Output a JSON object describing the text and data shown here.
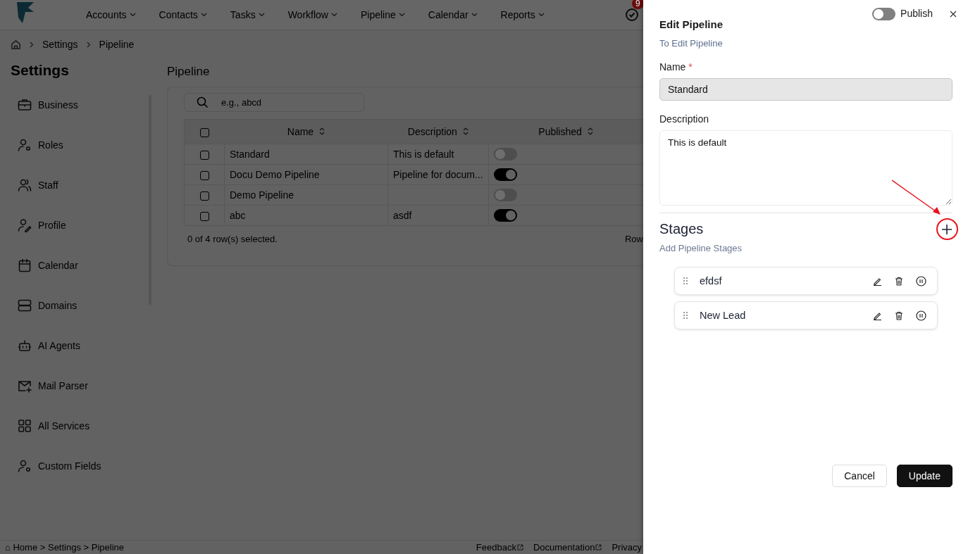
{
  "nav": {
    "items": [
      {
        "label": "Accounts"
      },
      {
        "label": "Contacts"
      },
      {
        "label": "Tasks"
      },
      {
        "label": "Workflow"
      },
      {
        "label": "Pipeline"
      },
      {
        "label": "Calendar"
      },
      {
        "label": "Reports"
      }
    ],
    "badge": "9"
  },
  "breadcrumb": [
    "Settings",
    "Pipeline"
  ],
  "sidebar": {
    "title": "Settings",
    "items": [
      "Business",
      "Roles",
      "Staff",
      "Profile",
      "Calendar",
      "Domains",
      "AI Agents",
      "Mail Parser",
      "All Services",
      "Custom Fields"
    ]
  },
  "main": {
    "title": "Pipeline",
    "search": {
      "placeholder": "e.g., abcd"
    },
    "table": {
      "columns": [
        "Name",
        "Description",
        "Published"
      ],
      "rows": [
        {
          "name": "Standard",
          "description": "This is default",
          "published": false,
          "checked": false
        },
        {
          "name": "Docu Demo Pipeline",
          "description": "Pipeline for docum...",
          "published": true,
          "checked": false
        },
        {
          "name": "Demo Pipeline",
          "description": "",
          "published": false,
          "checked": false
        },
        {
          "name": "abc",
          "description": "asdf",
          "published": true,
          "checked": false
        }
      ],
      "header_checked": false,
      "selection": "0 of 4 row(s) selected.",
      "rows_label": "Row"
    }
  },
  "footer": {
    "path": "⌂ Home >  Settings >  Pipeline",
    "links": [
      "Feedback",
      "Documentation",
      "Privacy"
    ]
  },
  "drawer": {
    "title": "Edit Pipeline",
    "subtitle": "To Edit Pipeline",
    "publish": {
      "label": "Publish",
      "on": false
    },
    "name_label": "Name",
    "required": "*",
    "name_value": "Standard",
    "description_label": "Description",
    "description_value": "This is default",
    "stages_title": "Stages",
    "stages_subtitle": "Add Pipeline Stages",
    "stages": [
      {
        "name": "efdsf"
      },
      {
        "name": "New Lead"
      }
    ],
    "buttons": [
      {
        "label": "Cancel",
        "kind": "secondary"
      },
      {
        "label": "Update",
        "kind": "primary"
      }
    ],
    "annotation": {
      "arrow": true,
      "circle": true
    }
  }
}
